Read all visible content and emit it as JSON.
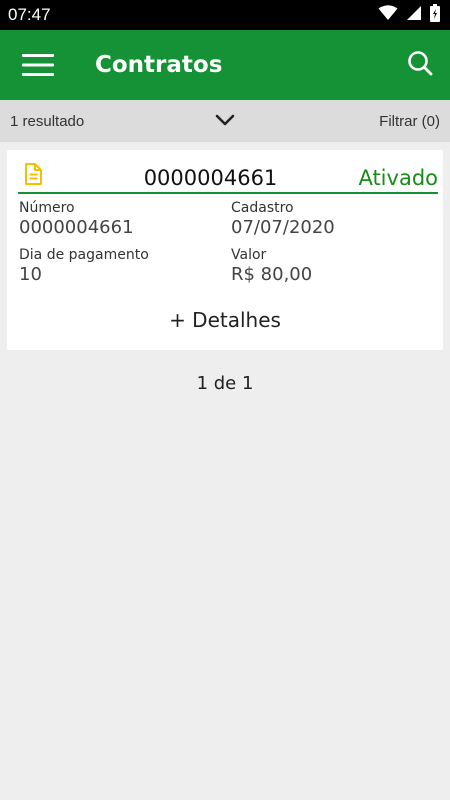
{
  "status_bar": {
    "time": "07:47"
  },
  "app_bar": {
    "title": "Contratos"
  },
  "filter_bar": {
    "result_count": "1 resultado",
    "filter_label": "Filtrar (0)"
  },
  "contract": {
    "number": "0000004661",
    "status": "Ativado",
    "status_color": "#1a8c1a",
    "fields": {
      "numero_label": "Número",
      "numero_value": "0000004661",
      "cadastro_label": "Cadastro",
      "cadastro_value": "07/07/2020",
      "dia_pagamento_label": "Dia de pagamento",
      "dia_pagamento_value": "10",
      "valor_label": "Valor",
      "valor_value": "R$ 80,00"
    },
    "details_label": "+ Detalhes"
  },
  "pagination": {
    "text": "1 de 1"
  },
  "colors": {
    "primary": "#149235",
    "background": "#eeeeee",
    "filter_bar": "#dcdcdc",
    "document_icon": "#f2c200"
  },
  "icons": [
    "wifi-icon",
    "signal-icon",
    "battery-icon",
    "menu-icon",
    "search-icon",
    "chevron-down-icon",
    "document-icon"
  ]
}
